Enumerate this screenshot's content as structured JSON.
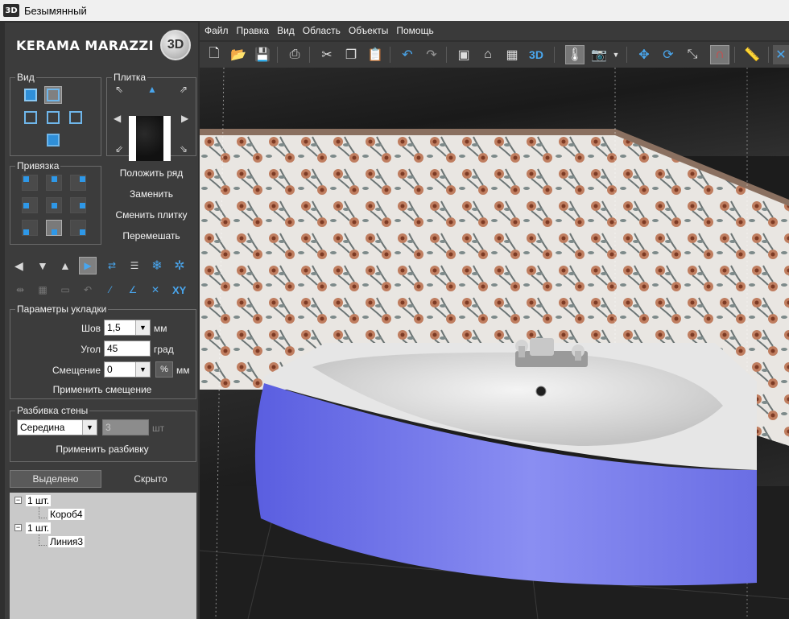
{
  "window": {
    "app_icon": "3D",
    "title": "Безымянный"
  },
  "brand": {
    "name": "KERAMA MARAZZI",
    "badge": "3D"
  },
  "menu": [
    "Файл",
    "Правка",
    "Вид",
    "Область",
    "Объекты",
    "Помощь"
  ],
  "toolbar": {
    "icons": [
      "new-file-icon",
      "open-folder-icon",
      "save-icon",
      "print-icon",
      "cut-icon",
      "copy-icon",
      "paste-icon",
      "undo-icon",
      "redo-icon",
      "plan-view-icon",
      "room-view-icon",
      "calculator-icon",
      "3d-view-icon",
      "light-icon",
      "camera-icon",
      "move-icon",
      "rotate-icon",
      "scale-icon",
      "magnet-icon",
      "ruler-icon",
      "close-icon"
    ],
    "label_3d": "3D"
  },
  "view_group": {
    "title": "Вид"
  },
  "tile_group": {
    "title": "Плитка"
  },
  "snap_group": {
    "title": "Привязка"
  },
  "tile_actions": {
    "lay_row": "Положить ряд",
    "replace": "Заменить",
    "change_tile": "Сменить плитку",
    "shuffle": "Перемешать"
  },
  "tools_row2_label": "XY",
  "params": {
    "title": "Параметры укладки",
    "seam_label": "Шов",
    "seam_value": "1,5",
    "seam_unit": "мм",
    "angle_label": "Угол",
    "angle_value": "45",
    "angle_unit": "град",
    "offset_label": "Смещение",
    "offset_value": "0",
    "offset_pct": "%",
    "offset_unit": "мм",
    "apply_offset": "Применить смещение"
  },
  "wall_split": {
    "title": "Разбивка стены",
    "mode_value": "Середина",
    "count_value": "3",
    "count_unit": "шт",
    "apply": "Применить разбивку"
  },
  "tabs": {
    "selected": "Выделено",
    "hidden": "Скрыто"
  },
  "tree": [
    {
      "count": "1 шт.",
      "child": "Короб4"
    },
    {
      "count": "1 шт.",
      "child": "Линия3"
    }
  ],
  "colors": {
    "accent": "#2f8fd8",
    "tub_panel": "#7a7ee8",
    "wall_tile_bg": "#e8e4e0",
    "flower": "#a85a3a"
  }
}
